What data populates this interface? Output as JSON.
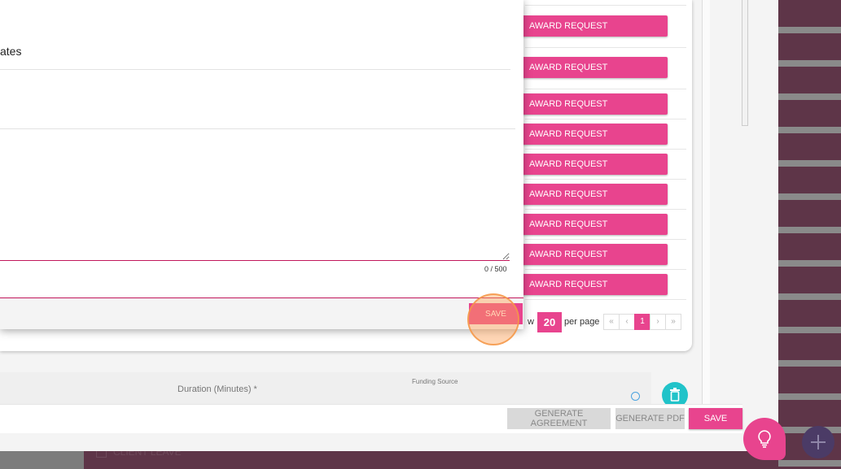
{
  "background": {
    "client_leave_label": "CLIENT LEAVE"
  },
  "modal": {
    "partial_text": "ates",
    "textarea_value": "",
    "char_count": "0 / 500",
    "save_label": "SAVE"
  },
  "award_list": {
    "button_label": "AWARD REQUEST",
    "items": [
      "AWARD REQUEST",
      "AWARD REQUEST",
      "AWARD REQUEST",
      "AWARD REQUEST",
      "AWARD REQUEST",
      "AWARD REQUEST",
      "AWARD REQUEST",
      "AWARD REQUEST",
      "AWARD REQUEST"
    ]
  },
  "pagination": {
    "show_label": "w",
    "page_size": "20",
    "per_page_label": "per page",
    "first": "«",
    "prev": "‹",
    "current_page": "1",
    "next": "›",
    "last": "»"
  },
  "form": {
    "duration_label": "Duration (Minutes) *",
    "funding_label": "Funding Source"
  },
  "footer": {
    "generate_agreement": "GENERATE AGREEMENT",
    "generate_pdf": "GENERATE PDF",
    "save": "SAVE"
  },
  "icons": {
    "trash": "trash-icon",
    "info": "info-icon",
    "lightbulb": "lightbulb-icon",
    "add": "plus-icon"
  },
  "colors": {
    "accent": "#e8448e",
    "teal": "#21c3c9",
    "maroon": "#5e3548",
    "purple": "#4b3b66"
  }
}
